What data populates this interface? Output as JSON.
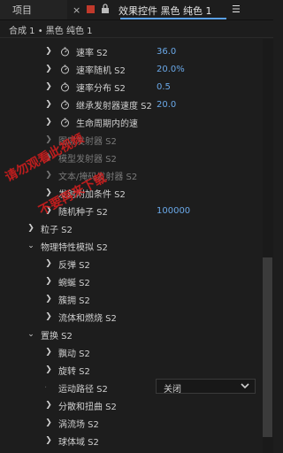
{
  "tabs": {
    "project_label": "项目",
    "active_title": "效果控件 黑色 纯色 1",
    "menu_glyph": "☰"
  },
  "comp_label": "合成 1 • 黑色 纯色 1",
  "rows": {
    "r1": {
      "label": "速率 S2",
      "value": "36.0"
    },
    "r2": {
      "label": "速率随机 S2",
      "value": "20.0%"
    },
    "r3": {
      "label": "速率分布 S2",
      "value": "0.5"
    },
    "r4": {
      "label": "继承发射器速度 S2",
      "value": "20.0"
    },
    "r5": {
      "label": "生命周期内的速"
    },
    "r6": {
      "label": "图层发射器 S2"
    },
    "r7": {
      "label": "模型发射器 S2"
    },
    "r8": {
      "label": "文本/掩码发射器 S2"
    },
    "r9": {
      "label": "发射附加条件 S2"
    },
    "r10": {
      "label": "随机种子 S2",
      "value": "100000"
    },
    "r11": {
      "label": "粒子 S2"
    },
    "r12": {
      "label": "物理特性模拟 S2"
    },
    "r13": {
      "label": "反弹 S2"
    },
    "r14": {
      "label": "蜿蜒 S2"
    },
    "r15": {
      "label": "簇拥 S2"
    },
    "r16": {
      "label": "流体和燃烧 S2"
    },
    "r17": {
      "label": "置换 S2"
    },
    "r18": {
      "label": "飘动 S2"
    },
    "r19": {
      "label": "旋转 S2"
    },
    "r20": {
      "label": "运动路径 S2",
      "value": "关闭"
    },
    "r21": {
      "label": "分散和扭曲 S2"
    },
    "r22": {
      "label": "涡流场 S2"
    },
    "r23": {
      "label": "球体域 S2"
    }
  },
  "watermark": {
    "line1": "请勿观看此视频",
    "line2": "不要再来下载"
  },
  "colors": {
    "value_blue": "#6aa8e8",
    "accent_red": "#c0392b",
    "watermark_red": "#d81e1e"
  }
}
